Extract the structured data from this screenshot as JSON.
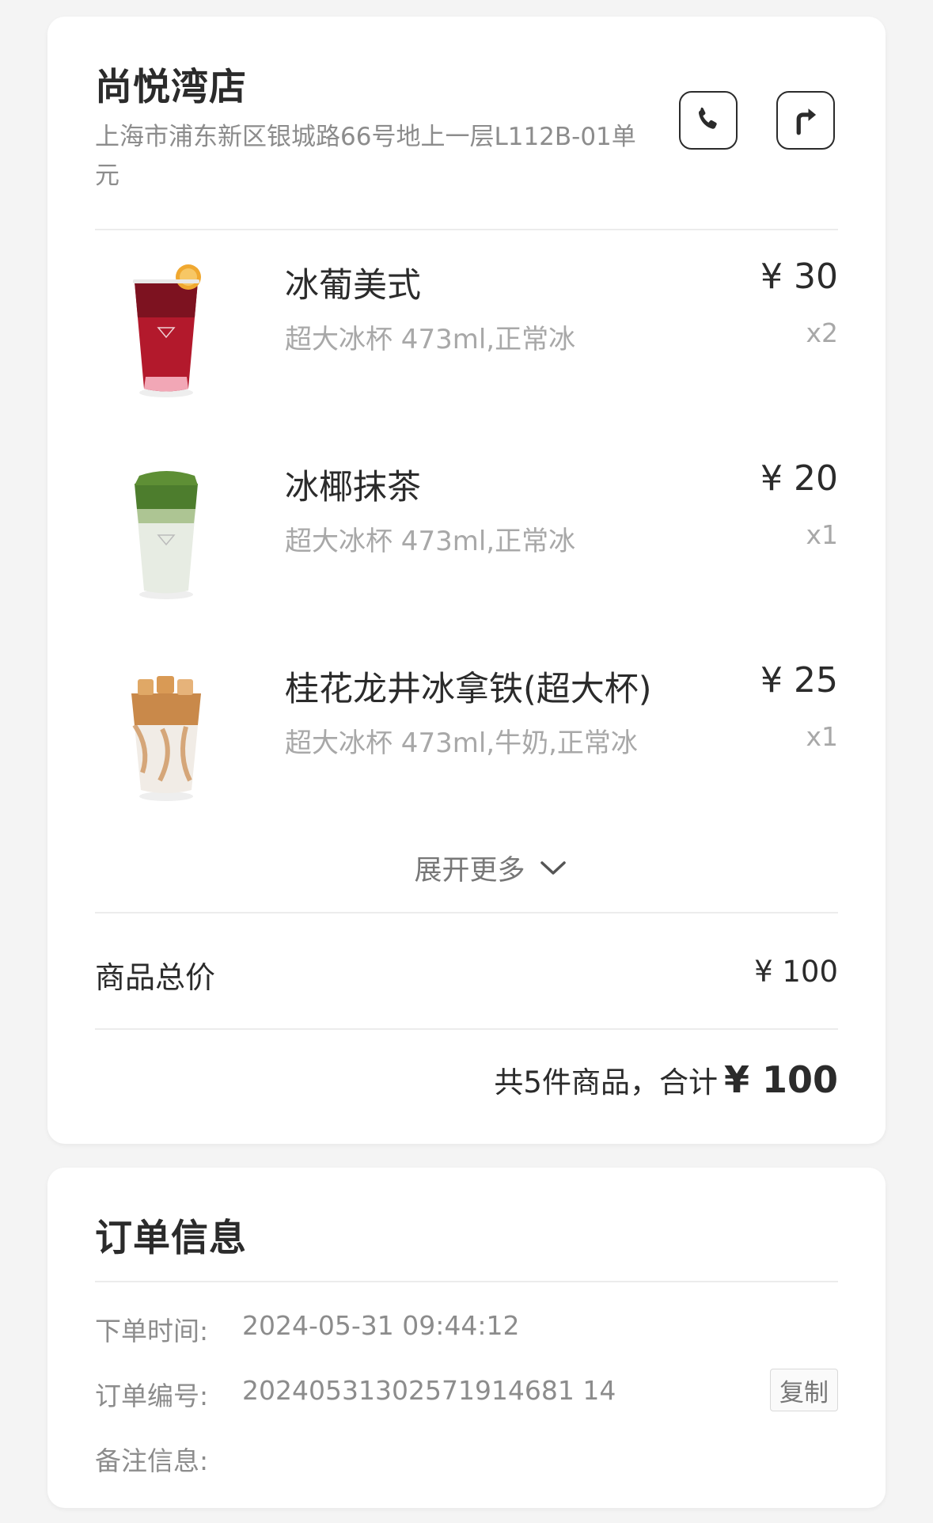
{
  "store": {
    "name": "尚悦湾店",
    "address": "上海市浦东新区银城路66号地上一层L112B-01单元",
    "call_icon": "phone-icon",
    "nav_icon": "directions-icon"
  },
  "items": [
    {
      "name": "冰葡美式",
      "spec": "超大冰杯 473ml,正常冰",
      "price": "¥ 30",
      "qty": "x2",
      "image": "iced-grape-americano-cup"
    },
    {
      "name": "冰椰抹茶",
      "spec": "超大冰杯 473ml,正常冰",
      "price": "¥ 20",
      "qty": "x1",
      "image": "iced-coconut-matcha-cup"
    },
    {
      "name": "桂花龙井冰拿铁(超大杯)",
      "spec": "超大冰杯 473ml,牛奶,正常冰",
      "price": "¥ 25",
      "qty": "x1",
      "image": "osmanthus-longjing-latte-cup"
    }
  ],
  "expand": {
    "label": "展开更多",
    "icon": "chevron-down-icon"
  },
  "totals": {
    "label": "商品总价",
    "value": "¥ 100",
    "summary_text": "共5件商品，合计",
    "summary_total": "¥ 100"
  },
  "order": {
    "title": "订单信息",
    "time_label": "下单时间:",
    "time_value": "2024-05-31 09:44:12",
    "number_label": "订单编号:",
    "number_value": "20240531302571914681 14",
    "copy_label": "复制",
    "remark_label": "备注信息:",
    "remark_value": ""
  },
  "colors": {
    "background": "#f4f4f4",
    "card": "#ffffff",
    "text": "#2b2b2b",
    "muted": "#a8a8a8"
  }
}
